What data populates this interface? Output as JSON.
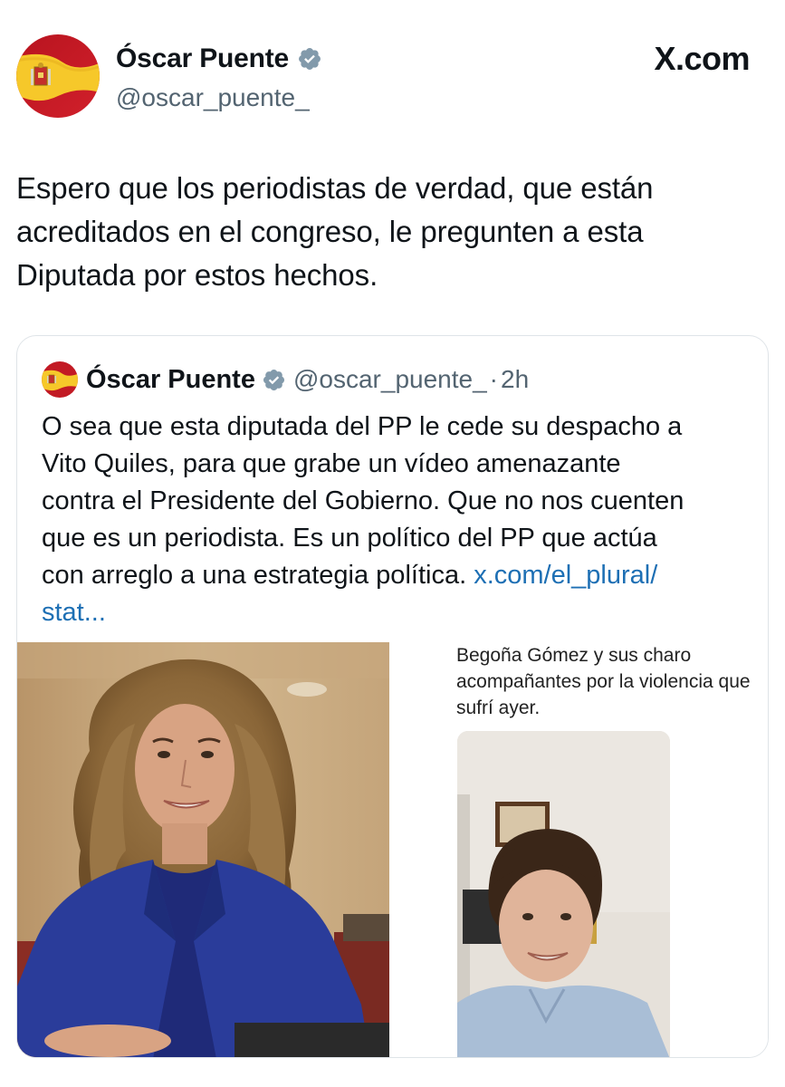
{
  "author": {
    "display_name": "Óscar Puente",
    "handle": "@oscar_puente_"
  },
  "brand": "X.com",
  "tweet": {
    "text_lines": [
      "Espero que los periodistas de verdad, que están",
      "acreditados en el congreso, le pregunten a esta",
      "Diputada por estos hechos."
    ]
  },
  "quoted_tweet": {
    "display_name": "Óscar Puente",
    "handle": "@oscar_puente_",
    "separator": "·",
    "time": "2h",
    "text_lines": [
      "O sea que esta diputada del PP le cede su despacho a",
      "Vito Quiles, para que grabe un vídeo amenazante",
      "contra el Presidente del Gobierno. Que no nos cuenten",
      "que es un periodista. Es un político del PP que actúa",
      "con arreglo a una estrategia política."
    ],
    "link_part1": "x.com/el_plural/",
    "link_part2": "stat..."
  },
  "media": {
    "caption_lines": [
      "Begoña Gómez y sus charo",
      "acompañantes por la violencia que",
      "sufrí ayer."
    ]
  },
  "icons": {
    "verified": "verified-badge-icon",
    "avatar": "spain-flag-avatar"
  },
  "colors": {
    "link": "#1d6fb4",
    "verified": "#829aab",
    "secondary_text": "#536471"
  }
}
